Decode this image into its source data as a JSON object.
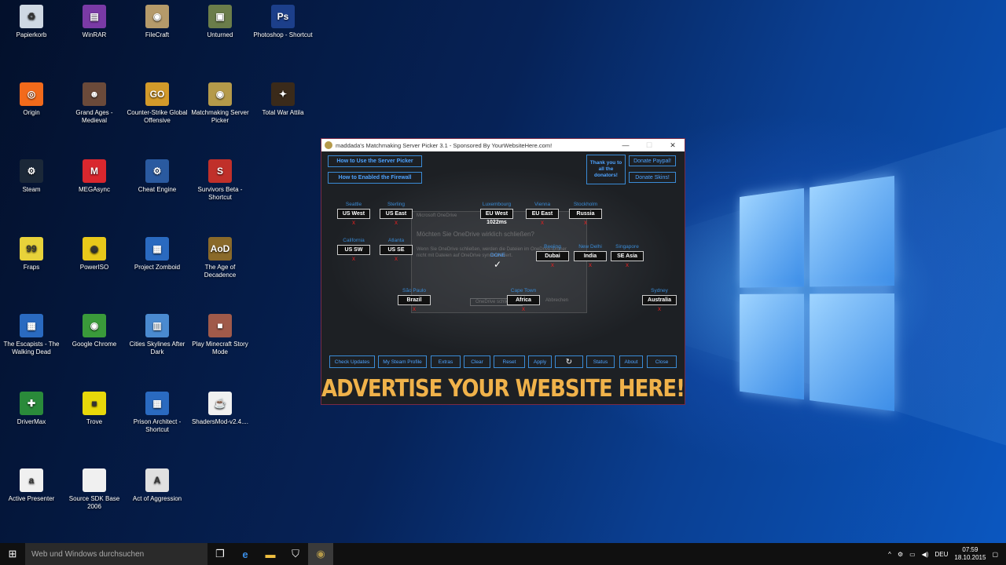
{
  "desktop_icons": [
    {
      "label": "Papierkorb",
      "icon": "recycle-bin-icon",
      "color": "#cfd8e3",
      "glyph": "♻"
    },
    {
      "label": "WinRAR",
      "icon": "winrar-icon",
      "color": "#7a3aa5",
      "glyph": "▤"
    },
    {
      "label": "FileCraft",
      "icon": "filecraft-icon",
      "color": "#b59a6a",
      "glyph": "◉"
    },
    {
      "label": "Unturned",
      "icon": "unturned-icon",
      "color": "#6b7d4a",
      "glyph": "▣"
    },
    {
      "label": "Photoshop - Shortcut",
      "icon": "photoshop-icon",
      "color": "#1c3f8a",
      "glyph": "Ps"
    },
    {
      "label": "Origin",
      "icon": "origin-icon",
      "color": "#f26a1b",
      "glyph": "◎"
    },
    {
      "label": "Grand Ages - Medieval",
      "icon": "grand-ages-icon",
      "color": "#6b4a3a",
      "glyph": "☻"
    },
    {
      "label": "Counter-Strike Global Offensive",
      "icon": "csgo-icon",
      "color": "#d39a2a",
      "glyph": "GO"
    },
    {
      "label": "Matchmaking Server Picker",
      "icon": "server-picker-icon",
      "color": "#b59a4a",
      "glyph": "◉"
    },
    {
      "label": "Total War Attila",
      "icon": "total-war-icon",
      "color": "#3a2a1a",
      "glyph": "✦"
    },
    {
      "label": "Steam",
      "icon": "steam-icon",
      "color": "#1b2838",
      "glyph": "⚙"
    },
    {
      "label": "MEGAsync",
      "icon": "mega-icon",
      "color": "#d9272e",
      "glyph": "M"
    },
    {
      "label": "Cheat Engine",
      "icon": "cheat-engine-icon",
      "color": "#2a5aa0",
      "glyph": "⚙"
    },
    {
      "label": "Survivors Beta - Shortcut",
      "icon": "survivors-icon",
      "color": "#c0302a",
      "glyph": "S"
    },
    {
      "label": "Fraps",
      "icon": "fraps-icon",
      "color": "#e8d23a",
      "glyph": "99"
    },
    {
      "label": "PowerISO",
      "icon": "poweriso-icon",
      "color": "#e8c81a",
      "glyph": "◉"
    },
    {
      "label": "Project Zomboid",
      "icon": "zomboid-icon",
      "color": "#2a6ac0",
      "glyph": "▦"
    },
    {
      "label": "The Age of Decadence",
      "icon": "decadence-icon",
      "color": "#8a6a2a",
      "glyph": "AoD"
    },
    {
      "label": "The Escapists - The Walking Dead",
      "icon": "escapists-icon",
      "color": "#2a6ac0",
      "glyph": "▦"
    },
    {
      "label": "Google Chrome",
      "icon": "chrome-icon",
      "color": "#3a9a3a",
      "glyph": "◉"
    },
    {
      "label": "Cities Skylines After Dark",
      "icon": "cities-icon",
      "color": "#4a8ad0",
      "glyph": "▥"
    },
    {
      "label": "Play Minecraft Story Mode",
      "icon": "minecraft-icon",
      "color": "#a05a4a",
      "glyph": "■"
    },
    {
      "label": "DriverMax",
      "icon": "drivermax-icon",
      "color": "#2a8a3a",
      "glyph": "✚"
    },
    {
      "label": "Trove",
      "icon": "trove-icon",
      "color": "#e8d80a",
      "glyph": "■"
    },
    {
      "label": "Prison Architect - Shortcut",
      "icon": "prison-architect-icon",
      "color": "#2a6ac0",
      "glyph": "▦"
    },
    {
      "label": "ShadersMod-v2.4....",
      "icon": "java-icon",
      "color": "#f0f0f0",
      "glyph": "☕"
    },
    {
      "label": "Active Presenter",
      "icon": "active-presenter-icon",
      "color": "#f0f0f0",
      "glyph": "a"
    },
    {
      "label": "Source SDK Base 2006",
      "icon": "file-icon",
      "color": "#f0f0f0",
      "glyph": " "
    },
    {
      "label": "Act of Aggression",
      "icon": "act-of-aggression-icon",
      "color": "#e0e0e0",
      "glyph": "A"
    }
  ],
  "window": {
    "title": "maddada's Matchmaking Server Picker 3.1 - Sponsored By YourWebsiteHere.com!",
    "btn_how_to_use": "How to Use the Server Picker",
    "btn_firewall": "How to Enabled the Firewall",
    "thank_you": "Thank you to all the donators!",
    "btn_donate_paypal": "Donate Paypal!",
    "btn_donate_skins": "Donate Skins!",
    "servers": [
      {
        "city": "Seattle",
        "name": "US West",
        "status": "x"
      },
      {
        "city": "Sterling",
        "name": "US East",
        "status": "x"
      },
      {
        "city": "Luxembourg",
        "name": "EU West",
        "status": "1022ms"
      },
      {
        "city": "Vienna",
        "name": "EU East",
        "status": "x"
      },
      {
        "city": "Stockholm",
        "name": "Russia",
        "status": "x"
      },
      {
        "city": "California",
        "name": "US SW",
        "status": "x"
      },
      {
        "city": "Atlanta",
        "name": "US SE",
        "status": "x"
      },
      {
        "city": "Beejing",
        "name": "Dubai",
        "status": "x"
      },
      {
        "city": "New Delhi",
        "name": "India",
        "status": "x"
      },
      {
        "city": "Singapore",
        "name": "SE Asia",
        "status": "x"
      },
      {
        "city": "São Paulo",
        "name": "Brazil",
        "status": "x"
      },
      {
        "city": "Cape Town",
        "name": "Africa",
        "status": "x"
      },
      {
        "city": "Sydney",
        "name": "Australia",
        "status": "x"
      }
    ],
    "overlay": {
      "heading": "Microsoft OneDrive",
      "question": "Möchten Sie OneDrive wirklich schließen?",
      "body": "Wenn Sie OneDrive schließen, werden die Dateien im OneDrive-Ordner nicht mit Dateien auf OneDrive synchronisiert.",
      "done": "DONE",
      "check": "✓",
      "btn_close": "OneDrive schließen",
      "btn_cancel": "Abbrechen"
    },
    "toolbar": [
      "Check Updates",
      "My Steam Profile",
      "Extras",
      "Clear",
      "Reset",
      "Apply",
      "↻",
      "Status",
      "About",
      "Close"
    ],
    "ad": "ADVERTISE YOUR WEBSITE HERE!"
  },
  "taskbar": {
    "search_placeholder": "Web und Windows durchsuchen",
    "lang": "DEU",
    "time": "07:59",
    "date": "18.10.2015"
  }
}
